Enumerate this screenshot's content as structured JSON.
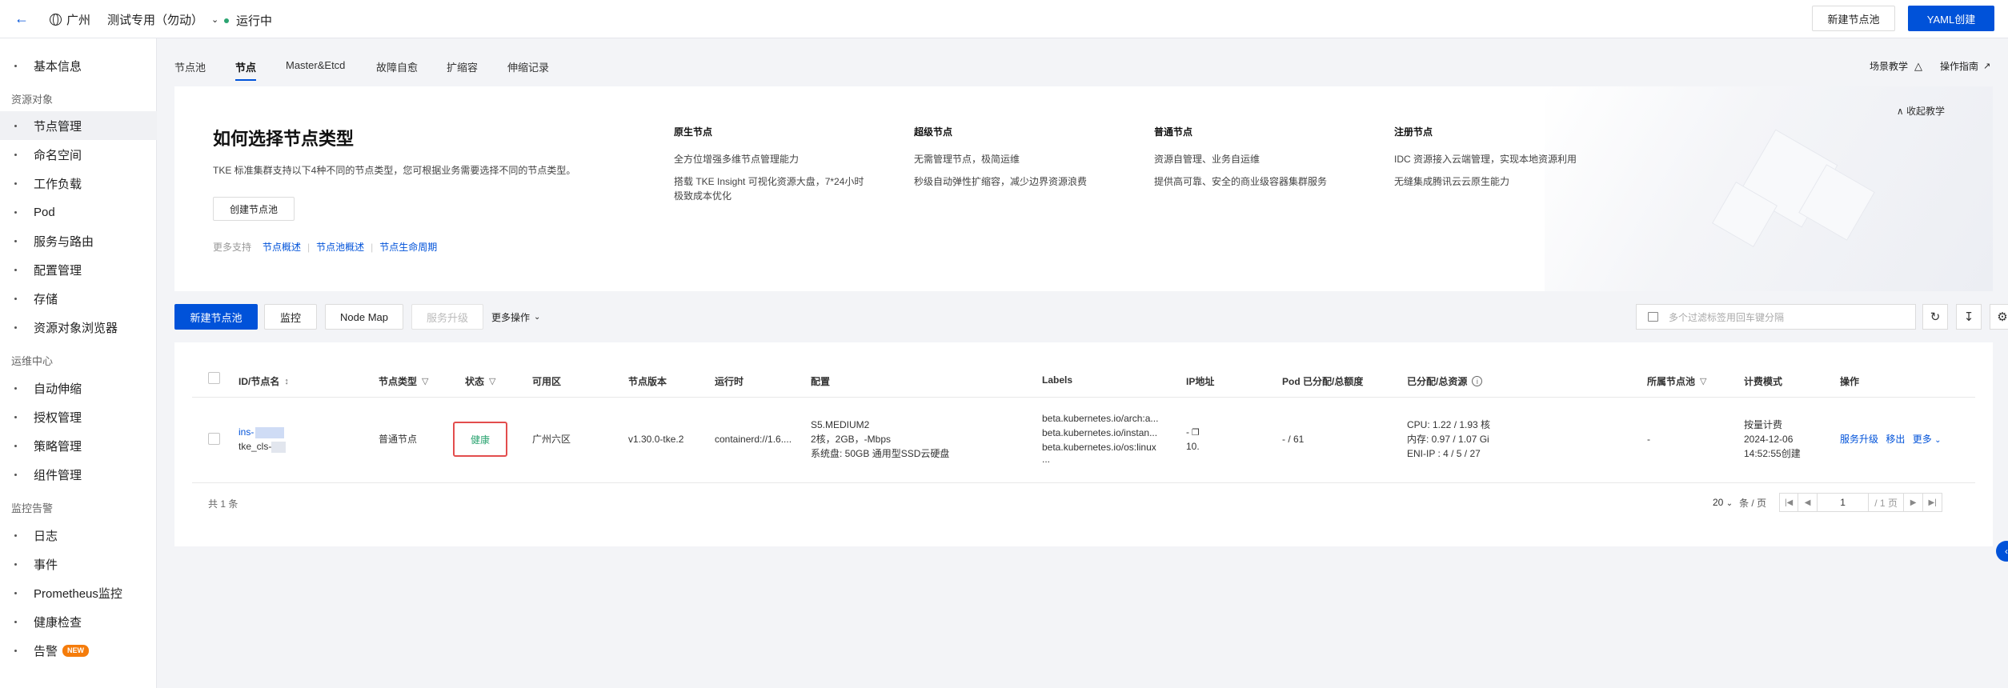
{
  "topbar": {
    "back_icon": "arrow-left-icon",
    "region": "广州",
    "cluster_name": "测试专用（勿动）",
    "status": "运行中",
    "status_color": "#2ba471",
    "new_pool_button": "新建节点池",
    "yaml_button": "YAML创建"
  },
  "sidebar": {
    "items": [
      {
        "label": "基本信息"
      },
      {
        "label": "节点管理"
      },
      {
        "label": "命名空间"
      },
      {
        "label": "工作负载"
      },
      {
        "label": "Pod"
      },
      {
        "label": "服务与路由"
      },
      {
        "label": "配置管理"
      },
      {
        "label": "存储"
      },
      {
        "label": "资源对象浏览器"
      },
      {
        "label": "自动伸缩"
      },
      {
        "label": "授权管理"
      },
      {
        "label": "策略管理"
      },
      {
        "label": "组件管理"
      },
      {
        "label": "日志"
      },
      {
        "label": "事件"
      },
      {
        "label": "Prometheus监控"
      },
      {
        "label": "健康检查"
      },
      {
        "label": "告警"
      }
    ],
    "groups": {
      "resources": "资源对象",
      "ops": "运维中心",
      "monitor": "监控告警"
    },
    "alarm_badge": "NEW"
  },
  "tabs": [
    "节点池",
    "节点",
    "Master&Etcd",
    "故障自愈",
    "扩缩容",
    "伸缩记录"
  ],
  "header_links": {
    "scenario": "场景教学",
    "guide": "操作指南"
  },
  "banner": {
    "title": "如何选择节点类型",
    "desc": "TKE 标准集群支持以下4种不同的节点类型，您可根据业务需要选择不同的节点类型。",
    "create_button": "创建节点池",
    "more_label": "更多支持",
    "links": [
      "节点概述",
      "节点池概述",
      "节点生命周期"
    ],
    "collapse": "收起教学",
    "columns": [
      {
        "title": "原生节点",
        "lines": [
          "全方位增强多维节点管理能力",
          "搭载 TKE Insight 可视化资源大盘，7*24小时",
          "极致成本优化"
        ]
      },
      {
        "title": "超级节点",
        "lines": [
          "无需管理节点，极简运维",
          "秒级自动弹性扩缩容，减少边界资源浪费"
        ]
      },
      {
        "title": "普通节点",
        "lines": [
          "资源自管理、业务自运维",
          "提供高可靠、安全的商业级容器集群服务"
        ]
      },
      {
        "title": "注册节点",
        "lines": [
          "IDC 资源接入云端管理，实现本地资源利用",
          "无缝集成腾讯云云原生能力"
        ]
      }
    ]
  },
  "toolbar": {
    "new_pool": "新建节点池",
    "monitor": "监控",
    "node_map": "Node Map",
    "upgrade": "服务升级",
    "more_ops": "更多操作",
    "search_placeholder": "多个过滤标签用回车键分隔"
  },
  "table": {
    "headers": [
      "ID/节点名",
      "节点类型",
      "状态",
      "可用区",
      "节点版本",
      "运行时",
      "配置",
      "Labels",
      "IP地址",
      "Pod 已分配/总额度",
      "已分配/总资源",
      "所属节点池",
      "计费模式",
      "操作"
    ],
    "row": {
      "id": "ins-",
      "name": "tke_cls-",
      "type": "普通节点",
      "status": "健康",
      "zone": "广州六区",
      "version": "v1.30.0-tke.2",
      "runtime": "containerd://1.6....",
      "config": [
        "S5.MEDIUM2",
        "2核，2GB，-Mbps",
        "系统盘: 50GB 通用型SSD云硬盘"
      ],
      "labels": [
        "beta.kubernetes.io/arch:a...",
        "beta.kubernetes.io/instan...",
        "beta.kubernetes.io/os:linux",
        "..."
      ],
      "ip": [
        "-",
        "10."
      ],
      "pods": "- / 61",
      "resources": [
        "CPU: 1.22 / 1.93 核",
        "内存: 0.97 / 1.07 Gi",
        "ENI-IP : 4 / 5 / 27"
      ],
      "pool": "-",
      "billing": [
        "按量计费",
        "2024-12-06",
        "14:52:55创建"
      ],
      "actions": [
        "服务升级",
        "移出",
        "更多"
      ]
    }
  },
  "footer": {
    "total": "共 1 条",
    "page_size": "20",
    "per_page": "条 / 页",
    "page": "1",
    "page_total": "/ 1 页"
  }
}
